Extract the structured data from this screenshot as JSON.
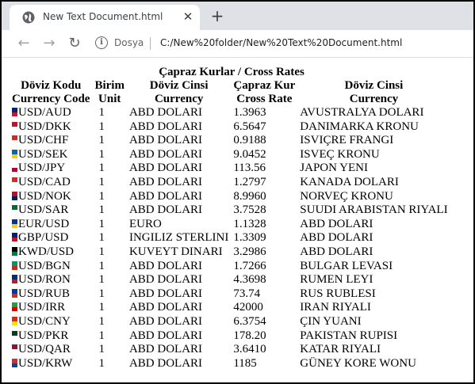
{
  "browser": {
    "tab_title": "New Text Document.html",
    "new_tab_symbol": "+",
    "site_label": "Dosya",
    "url": "C:/New%20folder/New%20Text%20Document.html"
  },
  "page": {
    "caption": "Çapraz Kurlar / Cross Rates",
    "headers": [
      [
        "Döviz Kodu",
        "Currency Code"
      ],
      [
        "Birim",
        "Unit"
      ],
      [
        "Döviz Cinsi",
        "Currency"
      ],
      [
        "Çapraz Kur",
        "Cross Rate"
      ],
      [
        "Döviz Cinsi",
        "Currency"
      ]
    ],
    "rows": [
      {
        "code": "USD/AUD",
        "unit": "1",
        "currency": "ABD DOLARI",
        "rate": "1.3963",
        "target": "AVUSTRALYA DOLARI",
        "flag": [
          "#00247d",
          "#cf142b"
        ]
      },
      {
        "code": "USD/DKK",
        "unit": "1",
        "currency": "ABD DOLARI",
        "rate": "6.5647",
        "target": "DANIMARKA KRONU",
        "flag": [
          "#c60c30",
          "#ffffff"
        ]
      },
      {
        "code": "USD/CHF",
        "unit": "1",
        "currency": "ABD DOLARI",
        "rate": "0.9188",
        "target": "ISVIÇRE FRANGI",
        "flag": [
          "#d52b1e",
          "#ffffff"
        ]
      },
      {
        "code": "USD/SEK",
        "unit": "1",
        "currency": "ABD DOLARI",
        "rate": "9.0452",
        "target": "ISVEÇ KRONU",
        "flag": [
          "#006aa7",
          "#fecc00"
        ]
      },
      {
        "code": "USD/JPY",
        "unit": "1",
        "currency": "ABD DOLARI",
        "rate": "113.56",
        "target": "JAPON YENI",
        "flag": [
          "#ffffff",
          "#bc002d"
        ]
      },
      {
        "code": "USD/CAD",
        "unit": "1",
        "currency": "ABD DOLARI",
        "rate": "1.2797",
        "target": "KANADA DOLARI",
        "flag": [
          "#d52b1e",
          "#ffffff"
        ]
      },
      {
        "code": "USD/NOK",
        "unit": "1",
        "currency": "ABD DOLARI",
        "rate": "8.9960",
        "target": "NORVEÇ KRONU",
        "flag": [
          "#ba0c2f",
          "#00205b"
        ]
      },
      {
        "code": "USD/SAR",
        "unit": "1",
        "currency": "ABD DOLARI",
        "rate": "3.7528",
        "target": "SUUDI ARABISTAN RIYALI",
        "flag": [
          "#006c35",
          "#ffffff"
        ]
      },
      {
        "code": "EUR/USD",
        "unit": "1",
        "currency": "EURO",
        "rate": "1.1328",
        "target": "ABD DOLARI",
        "flag": [
          "#003399",
          "#ffcc00"
        ]
      },
      {
        "code": "GBP/USD",
        "unit": "1",
        "currency": "INGILIZ STERLINI",
        "rate": "1.3309",
        "target": "ABD DOLARI",
        "flag": [
          "#012169",
          "#c8102e"
        ]
      },
      {
        "code": "KWD/USD",
        "unit": "1",
        "currency": "KUVEYT DINARI",
        "rate": "3.2986",
        "target": "ABD DOLARI",
        "flag": [
          "#000000",
          "#007a3d"
        ]
      },
      {
        "code": "USD/BGN",
        "unit": "1",
        "currency": "ABD DOLARI",
        "rate": "1.7266",
        "target": "BULGAR LEVASI",
        "flag": [
          "#00966e",
          "#d62612"
        ]
      },
      {
        "code": "USD/RON",
        "unit": "1",
        "currency": "ABD DOLARI",
        "rate": "4.3698",
        "target": "RUMEN LEYI",
        "flag": [
          "#002b7f",
          "#ce1126"
        ]
      },
      {
        "code": "USD/RUB",
        "unit": "1",
        "currency": "ABD DOLARI",
        "rate": "73.74",
        "target": "RUS RUBLESI",
        "flag": [
          "#0039a6",
          "#d52b1e"
        ]
      },
      {
        "code": "USD/IRR",
        "unit": "1",
        "currency": "ABD DOLARI",
        "rate": "42000",
        "target": "IRAN RIYALI",
        "flag": [
          "#239f40",
          "#da0000"
        ]
      },
      {
        "code": "USD/CNY",
        "unit": "1",
        "currency": "ABD DOLARI",
        "rate": "6.3754",
        "target": "ÇIN YUANI",
        "flag": [
          "#de2910",
          "#ffde00"
        ]
      },
      {
        "code": "USD/PKR",
        "unit": "1",
        "currency": "ABD DOLARI",
        "rate": "178.20",
        "target": "PAKISTAN RUPISI",
        "flag": [
          "#01411c",
          "#ffffff"
        ]
      },
      {
        "code": "USD/QAR",
        "unit": "1",
        "currency": "ABD DOLARI",
        "rate": "3.6410",
        "target": "KATAR RIYALI",
        "flag": [
          "#8a1538",
          "#ffffff"
        ]
      },
      {
        "code": "USD/KRW",
        "unit": "1",
        "currency": "ABD DOLARI",
        "rate": "1185",
        "target": "GÜNEY KORE WONU",
        "flag": [
          "#cd2e3a",
          "#0047a0"
        ]
      }
    ]
  }
}
